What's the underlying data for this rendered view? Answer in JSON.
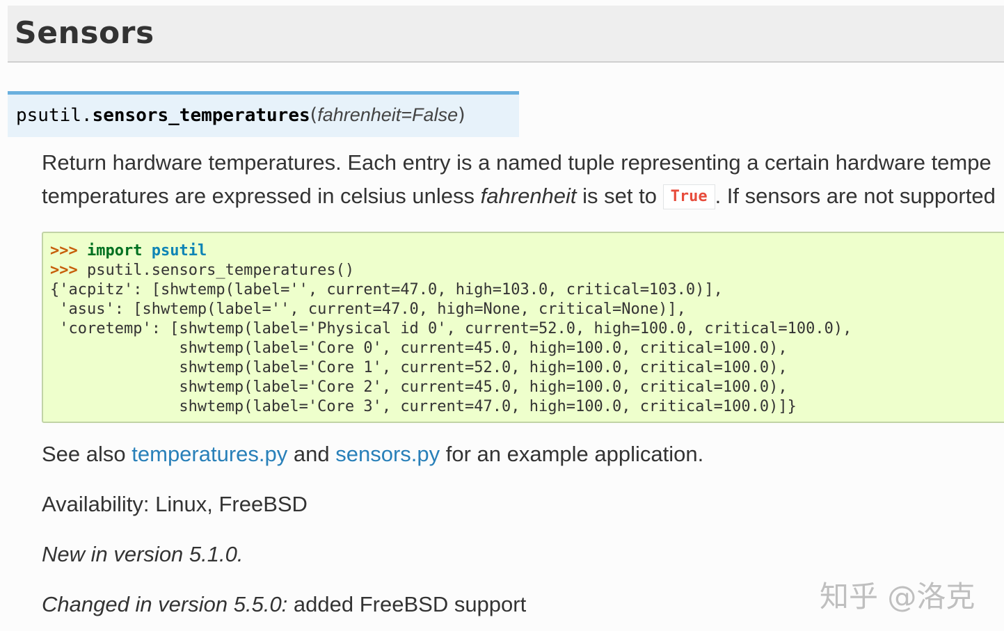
{
  "section": {
    "title": "Sensors"
  },
  "signature": {
    "module": "psutil.",
    "name": "sensors_temperatures",
    "open_paren": "(",
    "param": "fahrenheit=False",
    "close_paren": ")"
  },
  "description": {
    "line1": "Return hardware temperatures. Each entry is a named tuple representing a certain hardware tempe",
    "line2_before": "temperatures are expressed in celsius unless ",
    "line2_em": "fahrenheit",
    "line2_mid": " is set to ",
    "line2_code": "True",
    "line2_after": ". If sensors are not supported"
  },
  "code": {
    "prompt": ">>>",
    "line1_keyword": "import",
    "line1_module": "psutil",
    "line2": "psutil.sensors_temperatures()",
    "output": [
      "{'acpitz': [shwtemp(label='', current=47.0, high=103.0, critical=103.0)],",
      " 'asus': [shwtemp(label='', current=47.0, high=None, critical=None)],",
      " 'coretemp': [shwtemp(label='Physical id 0', current=52.0, high=100.0, critical=100.0),",
      "              shwtemp(label='Core 0', current=45.0, high=100.0, critical=100.0),",
      "              shwtemp(label='Core 1', current=52.0, high=100.0, critical=100.0),",
      "              shwtemp(label='Core 2', current=45.0, high=100.0, critical=100.0),",
      "              shwtemp(label='Core 3', current=47.0, high=100.0, critical=100.0)]}"
    ]
  },
  "see_also": {
    "before": "See also ",
    "link1": "temperatures.py",
    "middle": " and ",
    "link2": "sensors.py",
    "after": " for an example application."
  },
  "availability": "Availability: Linux, FreeBSD",
  "new_in": "New in version 5.1.0.",
  "changed": {
    "em": "Changed in version 5.5.0:",
    "text": " added FreeBSD support"
  },
  "watermark": "知乎 @洛克"
}
